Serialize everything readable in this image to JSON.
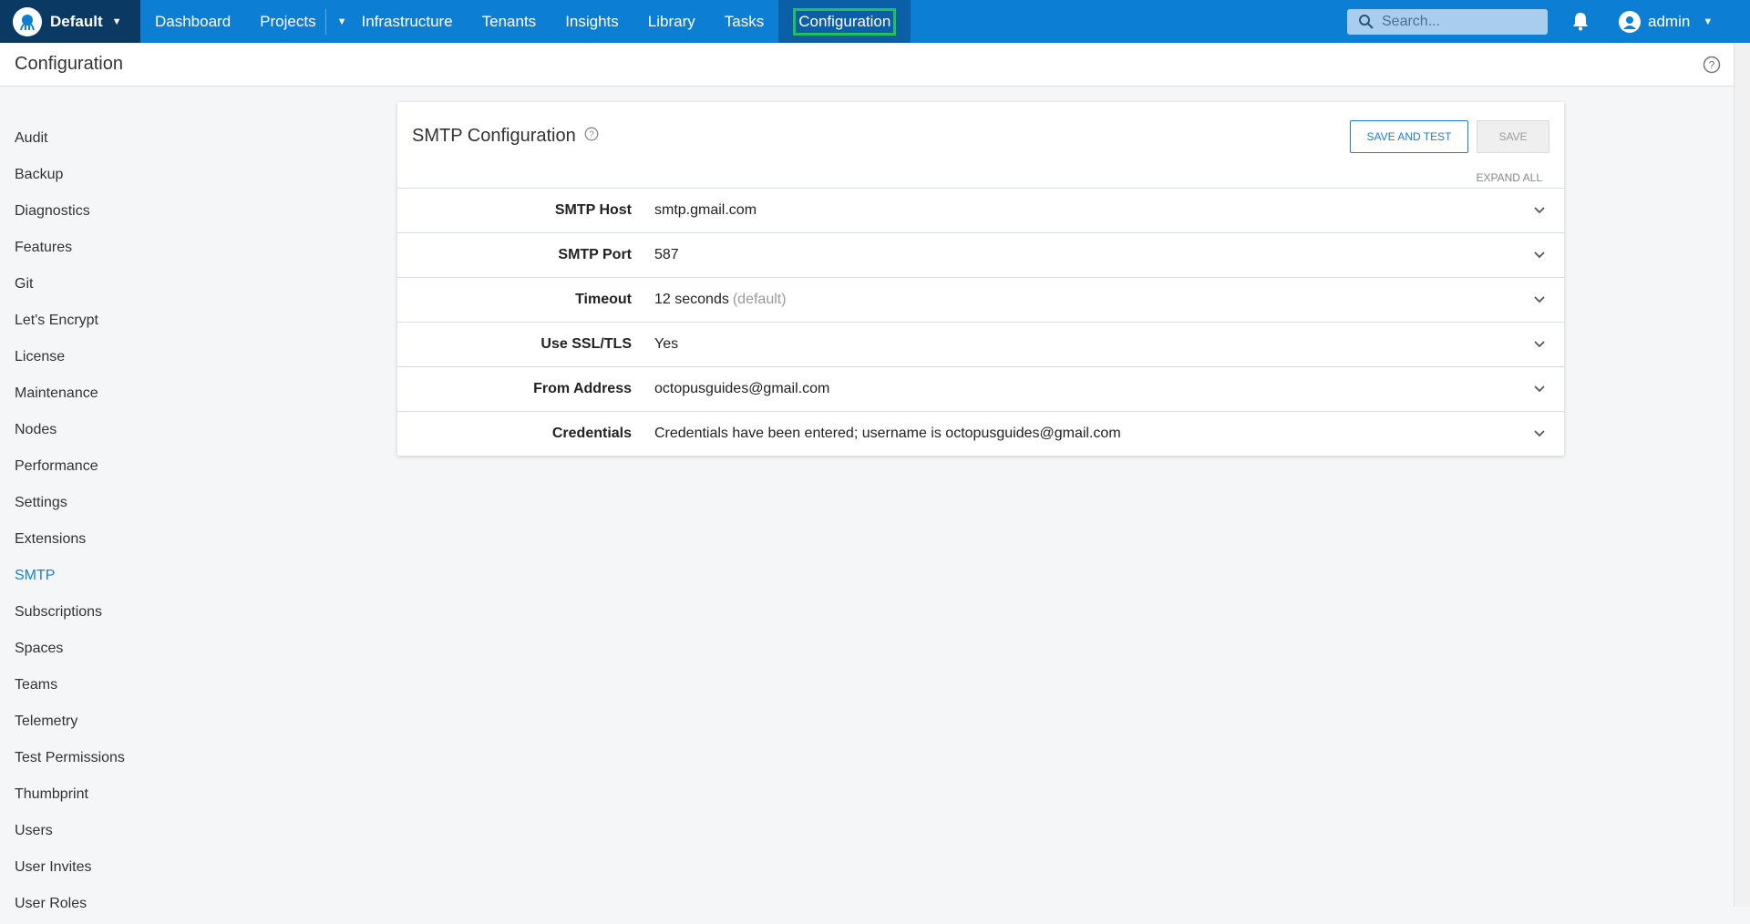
{
  "topnav": {
    "space_name": "Default",
    "items": [
      {
        "label": "Dashboard"
      },
      {
        "label": "Projects"
      },
      {
        "label": "Infrastructure"
      },
      {
        "label": "Tenants"
      },
      {
        "label": "Insights"
      },
      {
        "label": "Library"
      },
      {
        "label": "Tasks"
      },
      {
        "label": "Configuration"
      }
    ],
    "search_placeholder": "Search...",
    "username": "admin",
    "accent": "#0c7fd4",
    "highlight": "#21c05b"
  },
  "page": {
    "title": "Configuration"
  },
  "sidebar": {
    "items": [
      {
        "label": "Audit"
      },
      {
        "label": "Backup"
      },
      {
        "label": "Diagnostics"
      },
      {
        "label": "Features"
      },
      {
        "label": "Git"
      },
      {
        "label": "Let's Encrypt"
      },
      {
        "label": "License"
      },
      {
        "label": "Maintenance"
      },
      {
        "label": "Nodes"
      },
      {
        "label": "Performance"
      },
      {
        "label": "Settings"
      },
      {
        "label": "Extensions"
      },
      {
        "label": "SMTP"
      },
      {
        "label": "Subscriptions"
      },
      {
        "label": "Spaces"
      },
      {
        "label": "Teams"
      },
      {
        "label": "Telemetry"
      },
      {
        "label": "Test Permissions"
      },
      {
        "label": "Thumbprint"
      },
      {
        "label": "Users"
      },
      {
        "label": "User Invites"
      },
      {
        "label": "User Roles"
      }
    ],
    "active": "SMTP"
  },
  "smtp": {
    "title": "SMTP Configuration",
    "save_and_test_label": "SAVE AND TEST",
    "save_label": "SAVE",
    "expand_all_label": "EXPAND ALL",
    "rows": [
      {
        "label": "SMTP Host",
        "value": "smtp.gmail.com",
        "hint": ""
      },
      {
        "label": "SMTP Port",
        "value": "587",
        "hint": ""
      },
      {
        "label": "Timeout",
        "value": "12 seconds",
        "hint": "(default)"
      },
      {
        "label": "Use SSL/TLS",
        "value": "Yes",
        "hint": ""
      },
      {
        "label": "From Address",
        "value": "octopusguides@gmail.com",
        "hint": ""
      },
      {
        "label": "Credentials",
        "value": "Credentials have been entered; username is octopusguides@gmail.com",
        "hint": ""
      }
    ]
  }
}
